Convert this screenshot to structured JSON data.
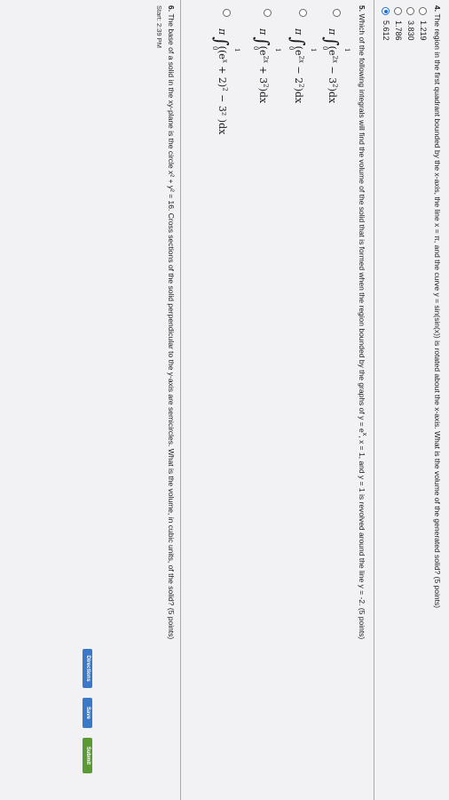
{
  "q4": {
    "number": "4.",
    "text": "The region in the first quadrant bounded by the x-axis, the line x = π, and the curve y = sin(sin(x)) is rotated about the x-axis. What is the volume of the generated solid? (5 points)",
    "options": [
      {
        "label": "1.219",
        "selected": false
      },
      {
        "label": "3.830",
        "selected": false
      },
      {
        "label": "1.786",
        "selected": false
      },
      {
        "label": "5.612",
        "selected": true
      }
    ]
  },
  "q5": {
    "number": "5.",
    "text": "Which of the following integrals will find the volume of the solid that is formed when the region bounded by the graphs of y = e",
    "text_sup": "x",
    "text_rest": ", x = 1, and y = 1 is revolved around the line y = -2. (5 points)",
    "options": [
      {
        "pi": "π",
        "lower": "0",
        "upper": "1",
        "body": "(e",
        "exp": "2x",
        "tail": " − 3",
        "tail_exp": "2",
        "end": ")dx"
      },
      {
        "pi": "π",
        "lower": "0",
        "upper": "1",
        "body": "(e",
        "exp": "2x",
        "tail": " − 2",
        "tail_exp": "2",
        "end": ")dx"
      },
      {
        "pi": "π",
        "lower": "0",
        "upper": "1",
        "body": "(e",
        "exp": "2x",
        "tail": " + 3",
        "tail_exp": "2",
        "end": ")dx"
      },
      {
        "pi": "π",
        "lower": "0",
        "upper": "1",
        "body": "((e",
        "exp": "x",
        "tail": " + 2)",
        "tail_exp": "2",
        "end": " − 3² )dx"
      }
    ]
  },
  "q6": {
    "number": "6.",
    "text": "The base of a solid in the xy-plane is the circle x² + y² = 16. Cross sections of the solid perpendicular to the y-axis are semicircles. What is the volume, in cubic units, of the solid? (5 points)"
  },
  "footer": {
    "start_time": "Start: 2:39 PM",
    "directions_label": "Directions",
    "save_label": "Save",
    "submit_label": "Submit"
  },
  "colors": {
    "accent_blue": "#1f6fd0",
    "button_green": "#5a9a35",
    "button_blue": "#3a78c8"
  },
  "dock": {
    "icons": [
      "finder-icon",
      "word-icon",
      "app-store-icon",
      "preview-icon",
      "facetime-icon",
      "itunes-icon",
      "chrome-icon",
      "notes-icon",
      "launchpad-icon",
      "system-preferences-icon",
      "photos-icon",
      "trash-icon"
    ]
  }
}
